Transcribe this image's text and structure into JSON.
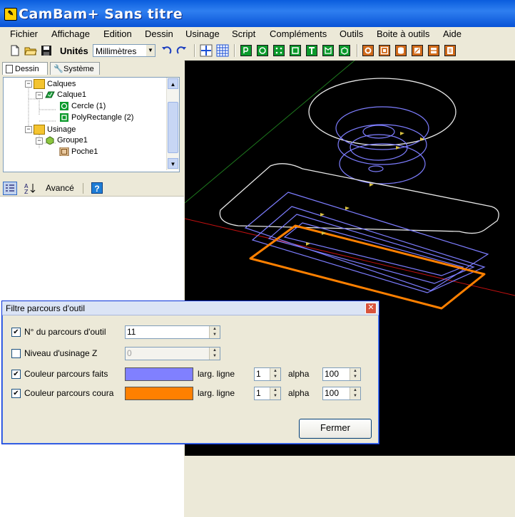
{
  "window": {
    "title": "CamBam+  Sans titre"
  },
  "menu": [
    "Fichier",
    "Affichage",
    "Edition",
    "Dessin",
    "Usinage",
    "Script",
    "Compléments",
    "Outils",
    "Boite à outils",
    "Aide"
  ],
  "toolbar": {
    "units_label": "Unités",
    "units_value": "Millimètres"
  },
  "tabs": {
    "dessin": "Dessin",
    "systeme": "Système"
  },
  "tree": {
    "calques": "Calques",
    "calque1": "Calque1",
    "cercle": "Cercle (1)",
    "polyrect": "PolyRectangle (2)",
    "usinage": "Usinage",
    "groupe1": "Groupe1",
    "poche1": "Poche1"
  },
  "propbar": {
    "advanced_label": "Avancé"
  },
  "dialog": {
    "title": "Filtre parcours d'outil",
    "toolpath_no_label": "N° du parcours d'outil",
    "toolpath_no_value": "11",
    "z_level_label": "Niveau d'usinage Z",
    "z_level_value": "0",
    "done_color_label": "Couleur parcours faits",
    "current_color_label": "Couleur parcours coura",
    "line_width_label": "larg. ligne",
    "alpha_label": "alpha",
    "done_line_width": "1",
    "done_alpha": "100",
    "current_line_width": "1",
    "current_alpha": "100",
    "close_label": "Fermer",
    "done_color": "#8080ff",
    "current_color": "#ff8000"
  },
  "colors": {
    "accent": "#0a5ddd",
    "viewport_bg": "#000000"
  }
}
